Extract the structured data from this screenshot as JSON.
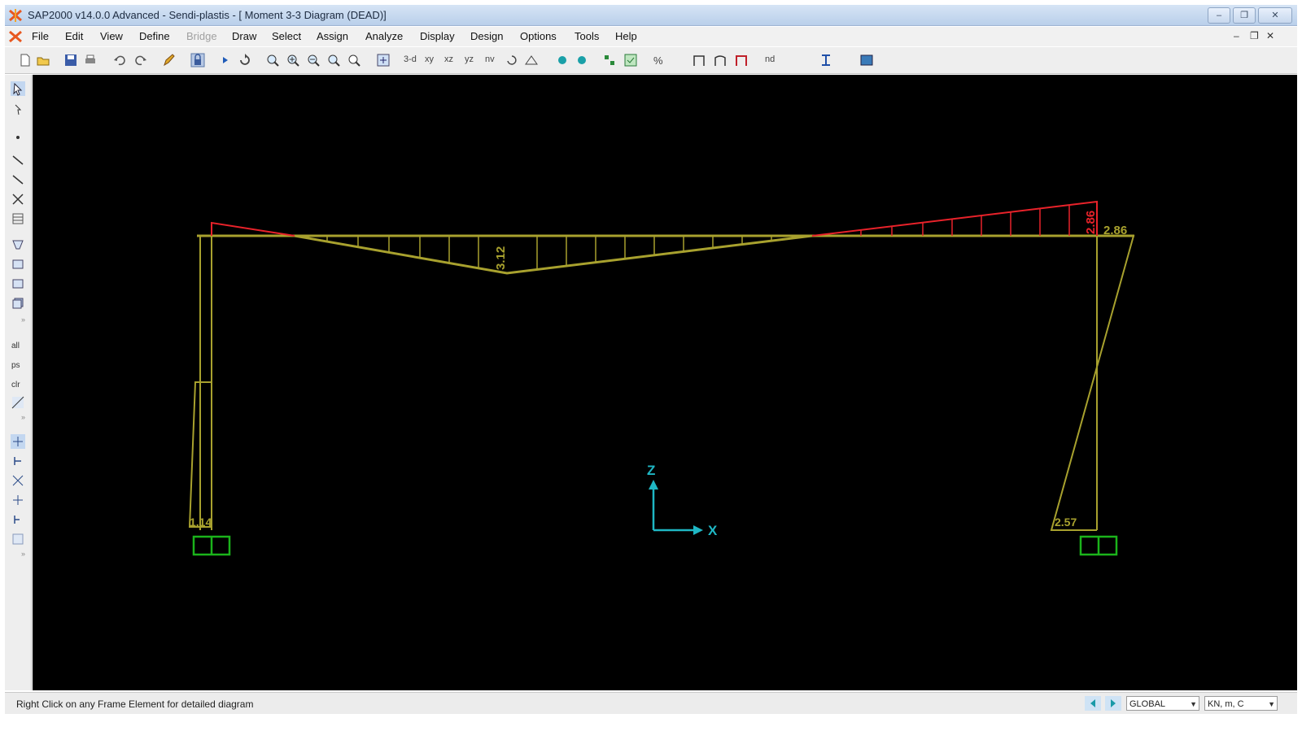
{
  "window": {
    "title": "SAP2000 v14.0.0 Advanced  - Sendi-plastis - [ Moment 3-3 Diagram  (DEAD)]"
  },
  "menu": {
    "items": [
      "File",
      "Edit",
      "View",
      "Define",
      "Bridge",
      "Draw",
      "Select",
      "Assign",
      "Analyze",
      "Display",
      "Design",
      "Options",
      "Tools",
      "Help"
    ],
    "disabled": [
      "Bridge"
    ]
  },
  "toolbar": {
    "view_labels": [
      "3-d",
      "xy",
      "xz",
      "yz",
      "nv"
    ]
  },
  "diagram": {
    "beam_mid_label": "3.12",
    "beam_right_neg_label": "2.86",
    "right_joint_label": "2.86",
    "left_base_label": "1.14",
    "right_base_label": "2.57",
    "axis_z": "Z",
    "axis_x": "X",
    "colors": {
      "positive": "#a8a12e",
      "negative": "#e8222a",
      "support": "#1bb31b",
      "axis": "#1fb7c4",
      "background": "#000000"
    }
  },
  "status": {
    "message": "Right Click on any Frame Element for detailed diagram",
    "coord_system": "GLOBAL",
    "units": "KN, m, C"
  }
}
